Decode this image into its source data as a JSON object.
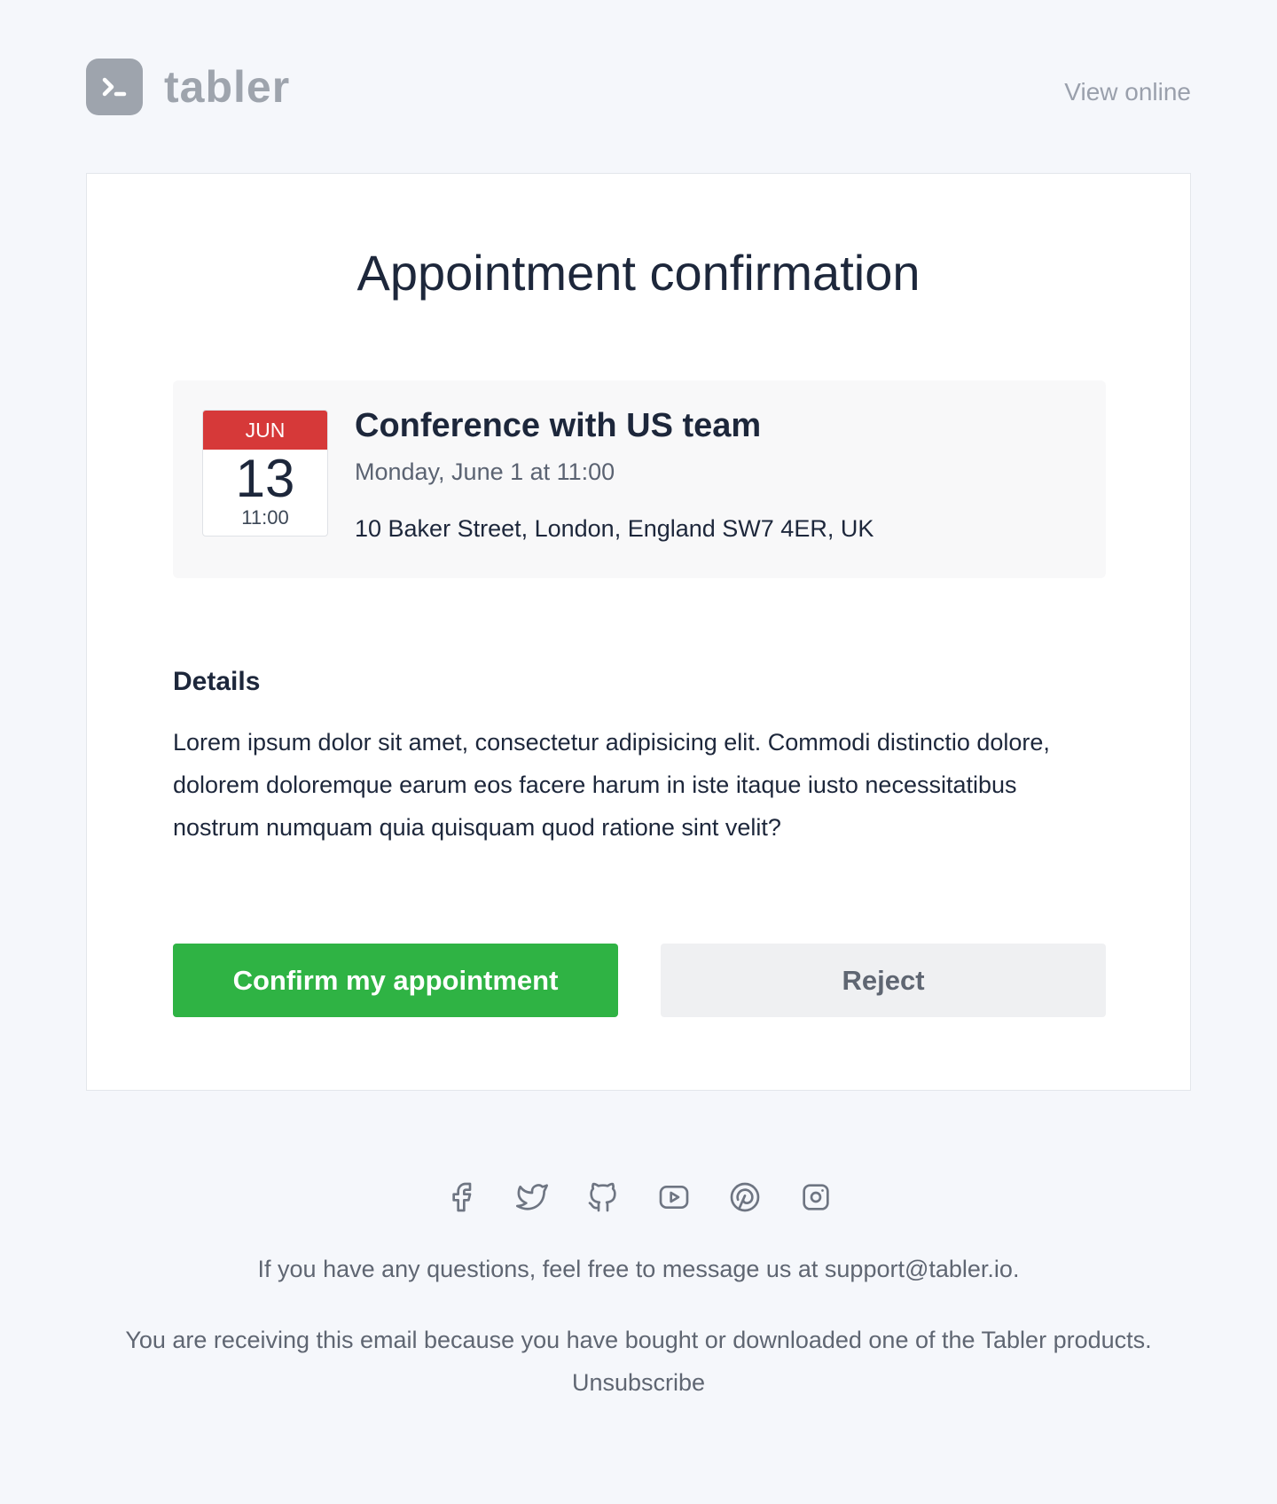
{
  "header": {
    "brand": "tabler",
    "view_online": "View online"
  },
  "card": {
    "title": "Appointment confirmation",
    "event": {
      "month": "JUN",
      "day": "13",
      "time": "11:00",
      "title": "Conference with US team",
      "date_text": "Monday, June 1 at 11:00",
      "address": "10 Baker Street, London, England SW7 4ER, UK"
    },
    "details": {
      "heading": "Details",
      "text": "Lorem ipsum dolor sit amet, consectetur adipisicing elit. Commodi distinctio dolore, dolorem doloremque earum eos facere harum in iste itaque iusto necessitatibus nostrum numquam quia quisquam quod ratione sint velit?"
    },
    "buttons": {
      "confirm": "Confirm my appointment",
      "reject": "Reject"
    }
  },
  "footer": {
    "social_icons": [
      "facebook-icon",
      "twitter-icon",
      "github-icon",
      "youtube-icon",
      "pinterest-icon",
      "instagram-icon"
    ],
    "support_text": "If you have any questions, feel free to message us at support@tabler.io.",
    "receiving_text": "You are receiving this email because you have bought or downloaded one of the Tabler products.",
    "unsubscribe": "Unsubscribe"
  },
  "colors": {
    "background": "#f5f7fb",
    "accent_green": "#2fb344",
    "calendar_red": "#d63939",
    "logo_gray": "#9ea4ad"
  }
}
